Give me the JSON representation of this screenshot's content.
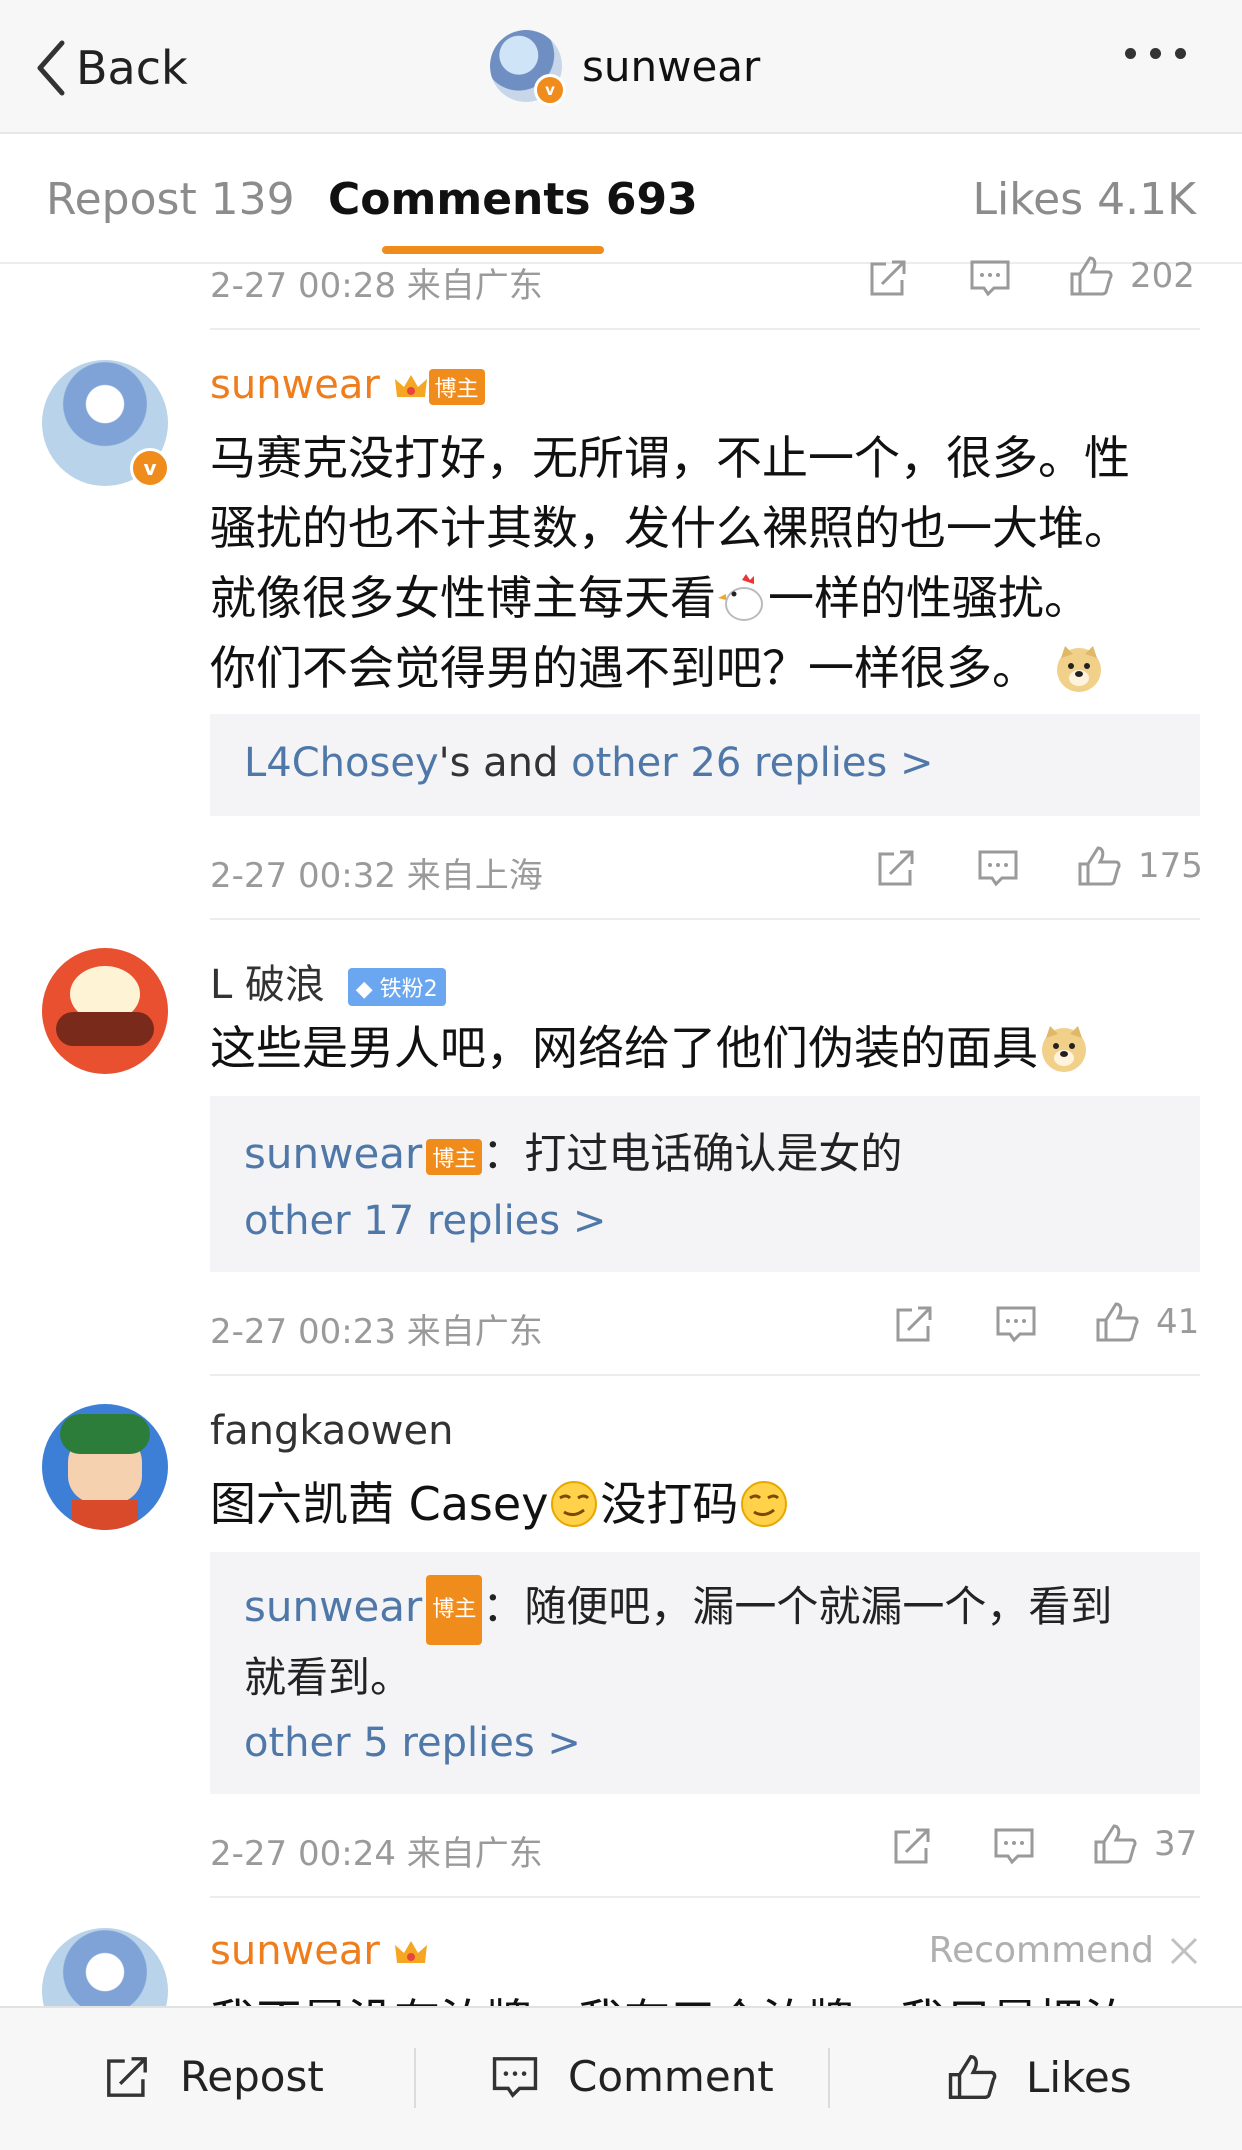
{
  "nav": {
    "back_label": "Back",
    "title": "sunwear"
  },
  "tabs": {
    "repost": "Repost 139",
    "comments": "Comments 693",
    "likes": "Likes 4.1K"
  },
  "prev_comment": {
    "meta": "2-27 00:28 来自广东",
    "likes": "202"
  },
  "comments": [
    {
      "user": "sunwear",
      "badge": "博主",
      "text": [
        "马赛克没打好，无所谓，不止一个，很多。性",
        "骚扰的也不计其数，发什么裸照的也一大堆。",
        "就像很多女性博主每天看",
        "一样的性骚扰。",
        "你们不会觉得男的遇不到吧？一样很多。"
      ],
      "replies": {
        "user": "L4Chosey",
        "mid": "'s and ",
        "link": "other 26 replies >"
      },
      "meta": "2-27 00:32 来自上海",
      "likes": "175"
    },
    {
      "user": "L 破浪",
      "badge": "铁粉2",
      "text": [
        "这些是男人吧，网络给了他们伪装的面具"
      ],
      "reply_user": "sunwear",
      "reply_badge": "博主",
      "reply_text": "：打过电话确认是女的",
      "more": "other 17 replies >",
      "meta": "2-27 00:23 来自广东",
      "likes": "41"
    },
    {
      "user": "fangkaowen",
      "text_a": "图六凯茜 Casey",
      "text_b": "没打码",
      "reply_user": "sunwear",
      "reply_badge": "博主",
      "reply_text": [
        "：随便吧，漏一个就漏一个，看到",
        "就看到。"
      ],
      "more": "other 5 replies >",
      "meta": "2-27 00:24 来自广东",
      "likes": "37"
    },
    {
      "user": "sunwear",
      "recommend": "Recommend",
      "text_partial": "我不是没有泊牌，我有三个泊牌，我只是把泊"
    }
  ],
  "bottom": {
    "repost": "Repost",
    "comment": "Comment",
    "likes": "Likes"
  },
  "colors": {
    "accent": "#f08c1c",
    "link": "#4f78a8"
  }
}
